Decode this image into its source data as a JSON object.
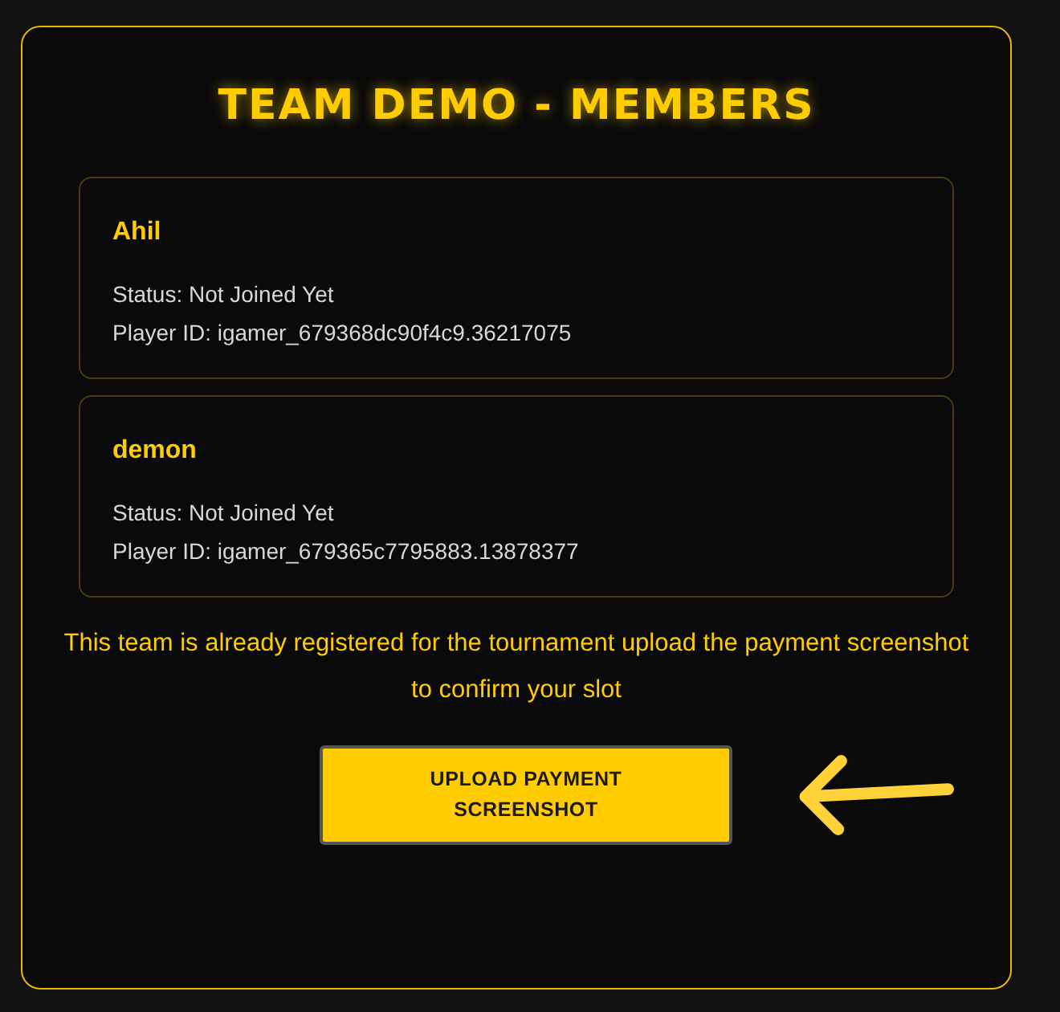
{
  "title": "TEAM DEMO - MEMBERS",
  "members": [
    {
      "name": "Ahil",
      "status": "Status: Not Joined Yet",
      "player_id": "Player ID: igamer_679368dc90f4c9.36217075"
    },
    {
      "name": "demon",
      "status": "Status: Not Joined Yet",
      "player_id": "Player ID: igamer_679365c7795883.13878377"
    }
  ],
  "notice": "This team is already registered for the tournament upload the payment screenshot to confirm your slot",
  "button": "UPLOAD PAYMENT SCREENSHOT"
}
